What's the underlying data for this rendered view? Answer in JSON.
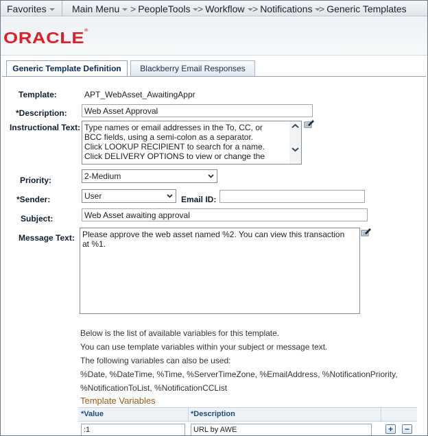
{
  "nav": {
    "favorites": "Favorites",
    "main_menu": "Main Menu",
    "breadcrumbs": [
      "PeopleTools",
      "Workflow",
      "Notifications",
      "Generic Templates"
    ]
  },
  "brand": {
    "logo": "ORACLE",
    "reg": "®",
    "color": "#e21e26"
  },
  "tabs": [
    {
      "label": "Generic Template Definition",
      "active": true
    },
    {
      "label": "Blackberry Email Responses",
      "active": false
    }
  ],
  "form": {
    "template_label": "Template:",
    "template_value": "APT_WebAsset_AwaitingAppr",
    "description_label": "*Description:",
    "description_value": "Web Asset Approval",
    "instructional_label": "Instructional Text:",
    "instructional_lines": [
      "Type names or email addresses in the To, CC, or",
      "BCC fields, using a semi-colon as a separator.",
      "Click LOOKUP RECIPIENT to search for a name.",
      "Click DELIVERY OPTIONS to view or change the"
    ],
    "priority_label": "Priority:",
    "priority_value": "2-Medium",
    "sender_label": "*Sender:",
    "sender_value": "User",
    "email_id_label": "Email ID:",
    "email_id_value": "",
    "subject_label": "Subject:",
    "subject_value": "Web Asset awaiting approval",
    "message_label": "Message Text:",
    "message_lines": [
      "Please approve the web asset named %2. You can view this transaction",
      "at %1."
    ]
  },
  "info": {
    "line1": "Below is the list of available variables for this template.",
    "line2": "You can use template variables within your subject or message text.",
    "line3": "The following variables can also be used:",
    "line4": "%Date, %DateTime, %Time, %ServerTimeZone, %EmailAddress, %NotificationPriority,",
    "line5": "%NotificationToList, %NotificationCCList"
  },
  "grid": {
    "title": "Template Variables",
    "col_value": "*Value",
    "col_description": "*Description",
    "rows": [
      {
        "value": ":1",
        "description": "URL by AWE"
      }
    ],
    "add_symbol": "+",
    "remove_symbol": "−"
  }
}
